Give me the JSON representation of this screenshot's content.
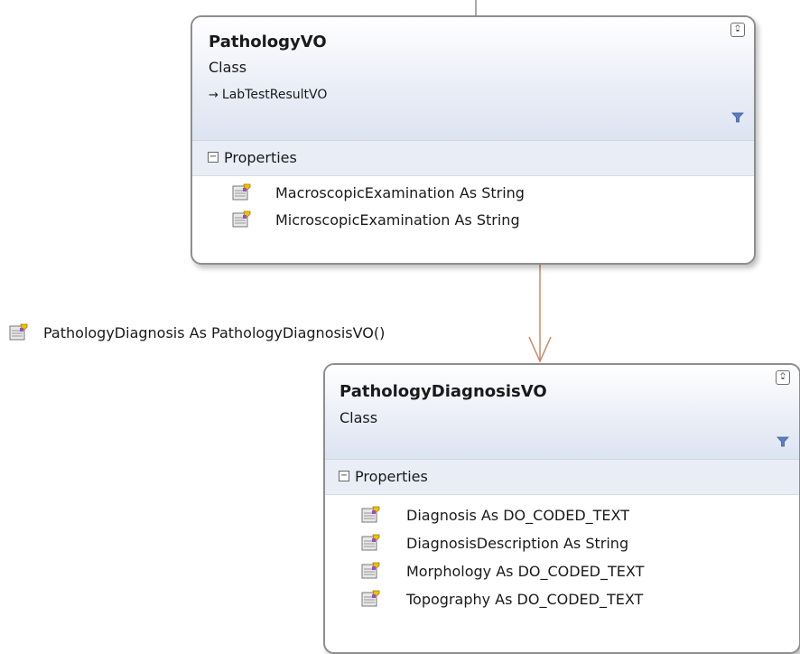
{
  "classes": [
    {
      "name": "PathologyVO",
      "kind": "Class",
      "inherits": "LabTestResultVO",
      "section_label": "Properties",
      "properties": [
        "MacroscopicExamination As String",
        "MicroscopicExamination As String"
      ]
    },
    {
      "name": "PathologyDiagnosisVO",
      "kind": "Class",
      "section_label": "Properties",
      "properties": [
        "Diagnosis As DO_CODED_TEXT",
        "DiagnosisDescription As String",
        "Morphology As DO_CODED_TEXT",
        "Topography As DO_CODED_TEXT"
      ]
    }
  ],
  "association": {
    "label": "PathologyDiagnosis As PathologyDiagnosisVO()"
  },
  "icons": {
    "collapse": "chevron-double-up-icon",
    "filter": "filter-icon",
    "section_toggle": "minus-box-icon",
    "property": "property-icon",
    "inherits": "inheritance-arrow-icon"
  },
  "colors": {
    "connector": "#c98a6a",
    "header_gradient_bottom": "#dde4f2",
    "border": "#8e8e8e"
  }
}
